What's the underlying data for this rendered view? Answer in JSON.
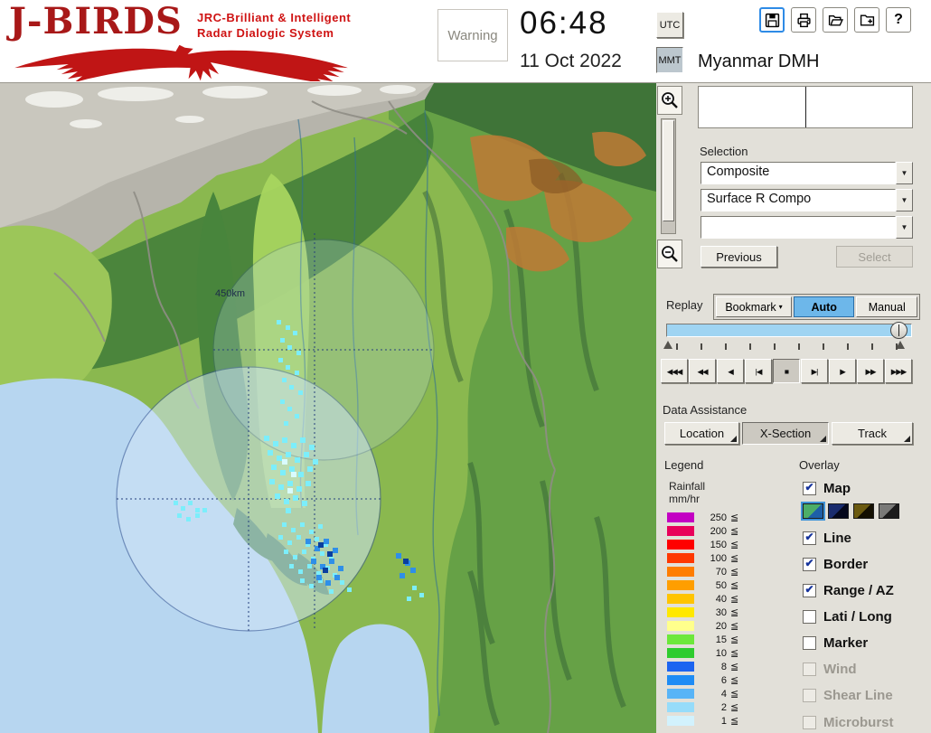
{
  "header": {
    "logo_title": "J-BIRDS",
    "tagline1": "JRC-Brilliant & Intelligent",
    "tagline2": "Radar  Dialogic  System",
    "warning": "Warning",
    "time": "06:48",
    "date": "11 Oct 2022",
    "utc": "UTC",
    "mmt": "MMT",
    "org": "Myanmar DMH",
    "help": "?"
  },
  "icons": {
    "save": "floppy-disk",
    "print": "printer",
    "open": "folder-open",
    "import": "folder-plus",
    "zoom_in": "magnifier-plus",
    "zoom_out": "magnifier-minus",
    "combo_arrow": "▼",
    "bookmark_arrow": "▾"
  },
  "map": {
    "range_label": "450km"
  },
  "selection": {
    "label": "Selection",
    "combo1": "Composite",
    "combo2": "Surface R Compo",
    "combo3": "",
    "previous": "Previous",
    "select": "Select"
  },
  "replay": {
    "label": "Replay",
    "bookmark": "Bookmark",
    "auto": "Auto",
    "manual": "Manual",
    "playback": [
      "◀◀◀",
      "◀◀",
      "◀",
      "|◀",
      "■",
      "▶|",
      "▶",
      "▶▶",
      "▶▶▶"
    ]
  },
  "assist": {
    "label": "Data Assistance",
    "location": "Location",
    "xsection": "X-Section",
    "track": "Track"
  },
  "legend": {
    "title": "Legend",
    "line1": "Rainfall",
    "line2": "mm/hr",
    "lte": "≦",
    "items": [
      {
        "value": "250",
        "color": "#c300c3"
      },
      {
        "value": "200",
        "color": "#e8005a"
      },
      {
        "value": "150",
        "color": "#ff0000"
      },
      {
        "value": "100",
        "color": "#ff3800"
      },
      {
        "value": "70",
        "color": "#ff7d00"
      },
      {
        "value": "50",
        "color": "#ff9e00"
      },
      {
        "value": "40",
        "color": "#ffc400"
      },
      {
        "value": "30",
        "color": "#ffe800"
      },
      {
        "value": "20",
        "color": "#ffff8c"
      },
      {
        "value": "15",
        "color": "#6ce83a"
      },
      {
        "value": "10",
        "color": "#2ecc2e"
      },
      {
        "value": "8",
        "color": "#1c64f0"
      },
      {
        "value": "6",
        "color": "#1e8cf5"
      },
      {
        "value": "4",
        "color": "#58b4f7"
      },
      {
        "value": "2",
        "color": "#96dcfa"
      },
      {
        "value": "1",
        "color": "#d2f2fd"
      }
    ]
  },
  "overlay": {
    "title": "Overlay",
    "items": [
      {
        "label": "Map",
        "check": "✔"
      },
      {
        "label": "Line",
        "check": "✔"
      },
      {
        "label": "Border",
        "check": "✔"
      },
      {
        "label": "Range / AZ",
        "check": "✔"
      },
      {
        "label": "Lati / Long",
        "check": ""
      },
      {
        "label": "Marker",
        "check": ""
      },
      {
        "label": "Wind",
        "check": ""
      },
      {
        "label": "Shear Line",
        "check": ""
      },
      {
        "label": "Microburst",
        "check": ""
      }
    ],
    "map_styles": [
      "#3f9e63",
      "#131f4d",
      "#4d3c0c",
      "#3a3a38"
    ]
  }
}
